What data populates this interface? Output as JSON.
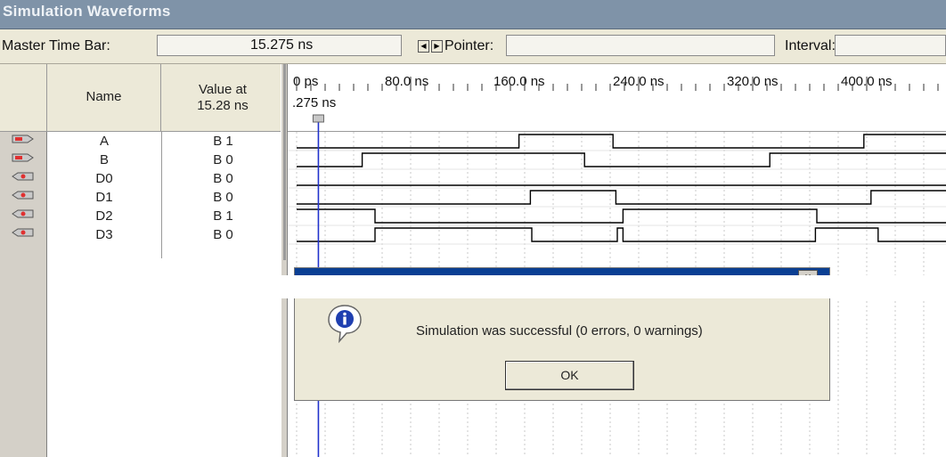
{
  "window": {
    "title": "Simulation Waveforms"
  },
  "toolbar": {
    "master_time_bar_label": "Master Time Bar:",
    "master_time_bar_value": "15.275 ns",
    "pointer_label": "Pointer:",
    "pointer_value": "",
    "interval_label": "Interval:",
    "interval_value": ""
  },
  "columns": {
    "name_header": "Name",
    "value_header_line1": "Value at",
    "value_header_line2": "15.28 ns"
  },
  "timeline": {
    "ticks": [
      "0 ps",
      "80.0 ns",
      "160.0 ns",
      "240.0 ns",
      "320.0 ns",
      "400.0 ns"
    ],
    "cursor_label": ".275 ns"
  },
  "signals": [
    {
      "name": "A",
      "value": "B 1",
      "type": "input",
      "transitions": [
        0,
        1,
        0,
        1,
        0
      ],
      "times": [
        0,
        156,
        222,
        398,
        500
      ]
    },
    {
      "name": "B",
      "value": "B 0",
      "type": "input",
      "transitions": [
        0,
        1,
        0,
        1
      ],
      "times": [
        0,
        46,
        202,
        332,
        500
      ]
    },
    {
      "name": "D0",
      "value": "B 0",
      "type": "output",
      "transitions": [
        0
      ],
      "times": [
        0,
        500
      ]
    },
    {
      "name": "D1",
      "value": "B 0",
      "type": "output",
      "transitions": [
        0,
        1,
        0,
        1
      ],
      "times": [
        0,
        164,
        224,
        403,
        500
      ]
    },
    {
      "name": "D2",
      "value": "B 1",
      "type": "output",
      "transitions": [
        1,
        0,
        1,
        0
      ],
      "times": [
        0,
        55,
        229,
        365,
        500
      ]
    },
    {
      "name": "D3",
      "value": "B 0",
      "type": "output",
      "transitions": [
        0,
        1,
        0,
        1,
        0,
        1,
        0
      ],
      "times": [
        0,
        55,
        165,
        225,
        229,
        364,
        408,
        500
      ]
    }
  ],
  "dialog": {
    "message": "Simulation was successful (0 errors, 0 warnings)",
    "ok_label": "OK",
    "close_label": "×",
    "icon": "info-icon"
  },
  "colors": {
    "title_bar": "#7f93a8",
    "cursor_line": "#2233cc",
    "dialog_title": "#0a3f93"
  }
}
